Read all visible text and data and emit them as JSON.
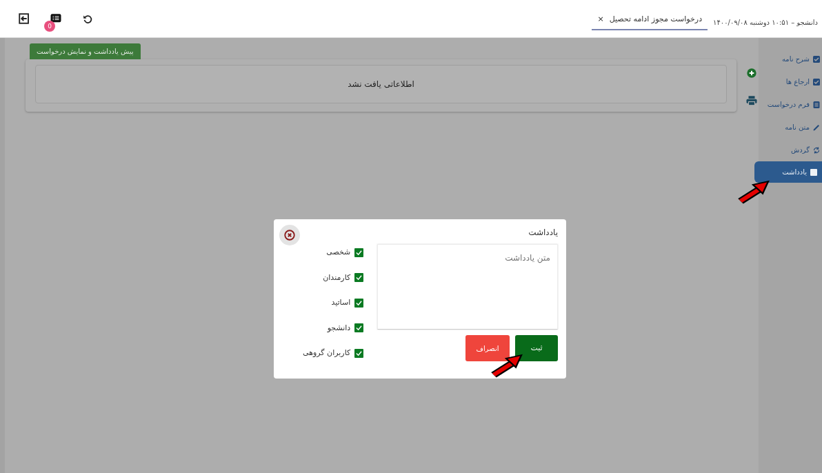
{
  "toolbar": {
    "notification_count": "0"
  },
  "tab": {
    "label": "درخواست مجوز ادامه تحصیل",
    "close": "×",
    "selected": true
  },
  "header_info": "دانشجو – ۱۰:۵۱ دوشنبه ۱۴۰۰/۰۹/۰۸",
  "sidebar": {
    "items": [
      {
        "label": "شرح نامه",
        "selected": false
      },
      {
        "label": "ارجاع ها",
        "selected": false
      },
      {
        "label": "فرم درخواست",
        "selected": false
      },
      {
        "label": "متن نامه",
        "selected": false
      },
      {
        "label": "گردش",
        "selected": false
      },
      {
        "label": "یادداشت",
        "selected": true
      }
    ]
  },
  "main": {
    "action_button": "پیش یادداشت و نمایش درخواست",
    "empty_message": "اطلاعاتی یافت نشد"
  },
  "dialog": {
    "title": "یادداشت",
    "text_placeholder": "متن یادداشت",
    "recipients": [
      {
        "label": "شخصی",
        "checked": true
      },
      {
        "label": "کارمندان",
        "checked": true
      },
      {
        "label": "اساتید",
        "checked": true
      },
      {
        "label": "دانشجو",
        "checked": true
      },
      {
        "label": "کاربران گروهی",
        "checked": true
      }
    ],
    "buttons": [
      {
        "label": "ثبت",
        "kind": "primary"
      },
      {
        "label": "انصراف",
        "kind": "cancel"
      }
    ]
  }
}
